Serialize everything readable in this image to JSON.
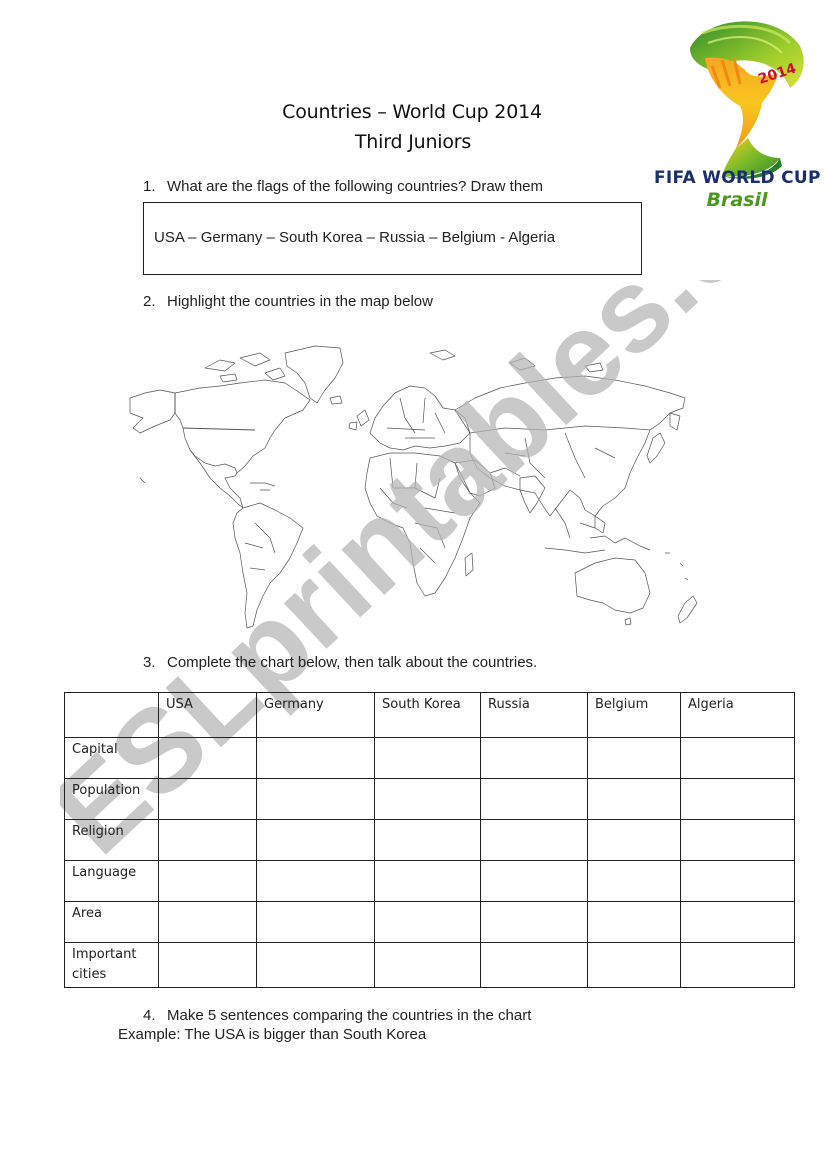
{
  "header": {
    "title": "Countries – World Cup 2014",
    "subtitle": "Third Juniors"
  },
  "logo": {
    "year": "2014",
    "line1": "FIFA WORLD CUP",
    "line2": "Brasil",
    "colors": {
      "navy": "#1b2f6e",
      "green": "#4a9a1c",
      "yellow": "#f7c51e",
      "orange": "#f39a1e",
      "red": "#c8102e"
    }
  },
  "questions": [
    {
      "number": "1.",
      "text": "What are the flags of the following countries? Draw them"
    },
    {
      "number": "2.",
      "text": "Highlight the countries in the map below"
    },
    {
      "number": "3.",
      "text": "Complete the chart below, then talk about the countries."
    },
    {
      "number": "4.",
      "text": "Make 5 sentences comparing the countries in the chart"
    }
  ],
  "flag_box": {
    "countries_text": "USA – Germany – South Korea – Russia – Belgium - Algeria"
  },
  "map": {
    "icon": "world-map-outline"
  },
  "chart": {
    "columns": [
      "",
      "USA",
      "Germany",
      "South Korea",
      "Russia",
      "Belgium",
      "Algeria"
    ],
    "rows": [
      {
        "label": "Capital",
        "cells": [
          "",
          "",
          "",
          "",
          "",
          ""
        ]
      },
      {
        "label": "Population",
        "cells": [
          "",
          "",
          "",
          "",
          "",
          ""
        ]
      },
      {
        "label": "Religion",
        "cells": [
          "",
          "",
          "",
          "",
          "",
          ""
        ]
      },
      {
        "label": "Language",
        "cells": [
          "",
          "",
          "",
          "",
          "",
          ""
        ]
      },
      {
        "label": "Area",
        "cells": [
          "",
          "",
          "",
          "",
          "",
          ""
        ]
      },
      {
        "label": "Important cities",
        "cells": [
          "",
          "",
          "",
          "",
          "",
          ""
        ]
      }
    ]
  },
  "example": "Example: The USA is bigger than South Korea",
  "watermark": {
    "text": "ESLprintables.com",
    "color": "#c8c8c8"
  }
}
